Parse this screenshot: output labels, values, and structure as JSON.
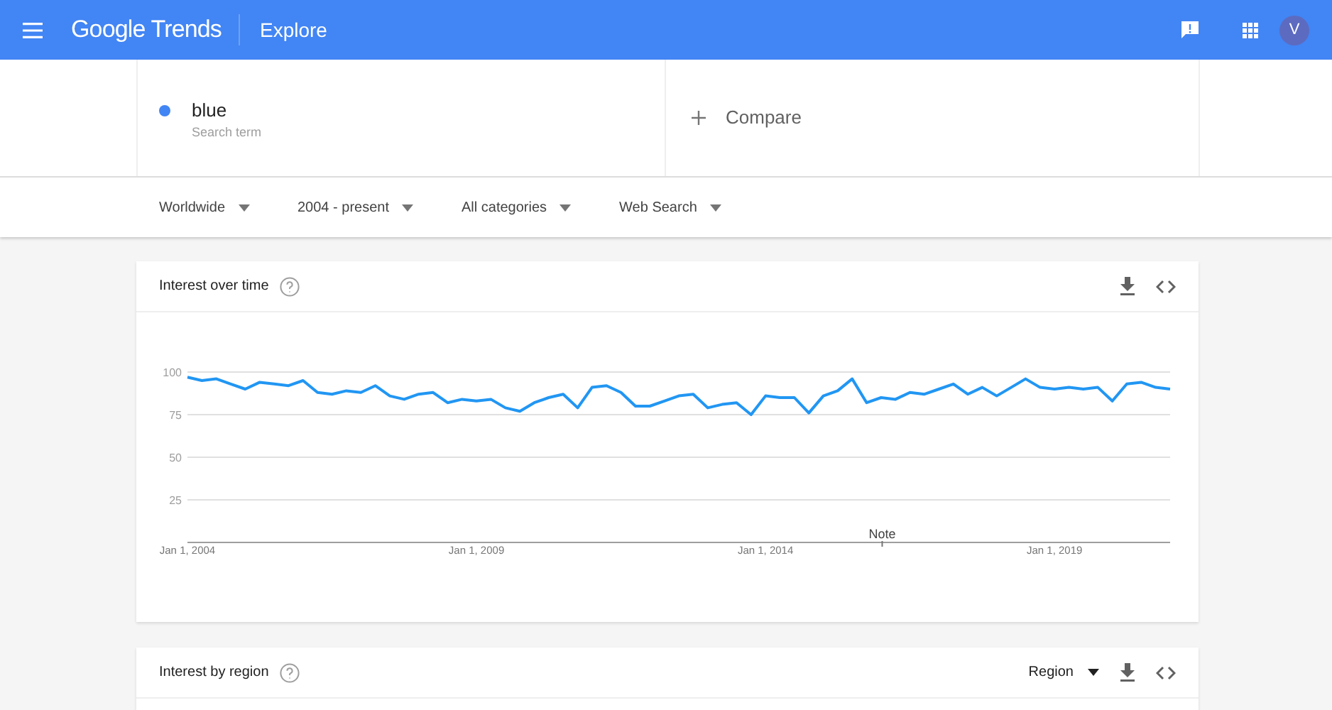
{
  "header": {
    "logo": "Google Trends",
    "section": "Explore",
    "avatar": "V"
  },
  "search_terms": [
    {
      "term": "blue",
      "subtitle": "Search term",
      "color": "#4285f4"
    }
  ],
  "compare": "Compare",
  "filters": [
    {
      "label": "Worldwide"
    },
    {
      "label": "2004 - present"
    },
    {
      "label": "All categories"
    },
    {
      "label": "Web Search"
    }
  ],
  "interest_over_time": {
    "title": "Interest over time",
    "chart_data": {
      "type": "line",
      "categories": [
        "Jan 1, 2004",
        null,
        null,
        null,
        null,
        null,
        null,
        null,
        null,
        null,
        null,
        null,
        null,
        null,
        null,
        null,
        null,
        null,
        null,
        null,
        "Jan 1, 2009",
        null,
        null,
        null,
        null,
        null,
        null,
        null,
        null,
        null,
        null,
        null,
        null,
        null,
        null,
        null,
        null,
        null,
        null,
        null,
        "Jan 1, 2014",
        null,
        null,
        null,
        null,
        null,
        null,
        null,
        null,
        null,
        null,
        null,
        null,
        null,
        null,
        null,
        null,
        null,
        null,
        null,
        "Jan 1, 2019",
        null,
        null,
        null,
        null,
        null,
        null,
        null,
        null
      ],
      "series": [
        {
          "color": "#2196f3",
          "values": [
            97,
            95,
            96,
            93,
            90,
            94,
            93,
            92,
            95,
            88,
            87,
            89,
            88,
            92,
            86,
            84,
            87,
            88,
            82,
            84,
            83,
            84,
            79,
            77,
            82,
            85,
            87,
            79,
            91,
            92,
            88,
            80,
            80,
            83,
            86,
            87,
            79,
            81,
            82,
            75,
            86,
            85,
            85,
            76,
            86,
            89,
            96,
            82,
            85,
            84,
            88,
            87,
            90,
            93,
            87,
            91,
            86,
            91,
            96,
            91,
            90,
            91,
            90,
            91,
            83,
            93,
            94,
            91,
            90
          ]
        }
      ],
      "ylim": [
        0,
        100
      ],
      "grid": true,
      "yticks": [
        25,
        50,
        75,
        100
      ],
      "annotations": [
        "Note"
      ]
    }
  },
  "interest_by_region": {
    "title": "Interest by region",
    "dropdown": "Region"
  }
}
